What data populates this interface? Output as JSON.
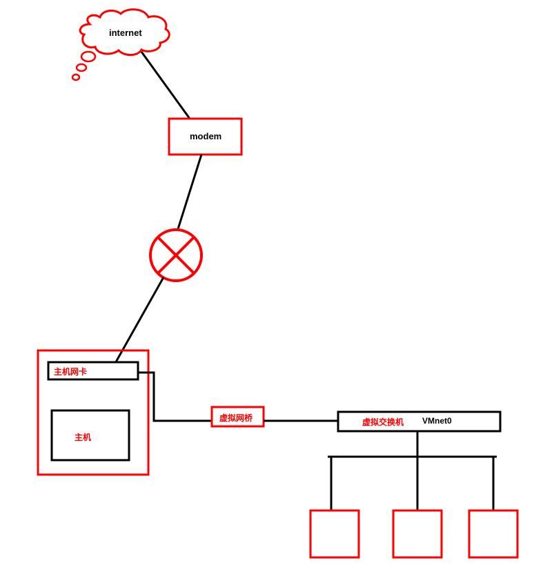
{
  "nodes": {
    "internet": {
      "label": "internet"
    },
    "modem": {
      "label": "modem"
    },
    "host_nic": {
      "label": "主机网卡"
    },
    "host": {
      "label": "主机"
    },
    "virtual_bridge": {
      "label": "虚拟网桥"
    },
    "virtual_switch": {
      "label": "虚拟交换机",
      "name": "VMnet0"
    }
  },
  "colors": {
    "accent": "#ff0000",
    "line": "#000000"
  }
}
